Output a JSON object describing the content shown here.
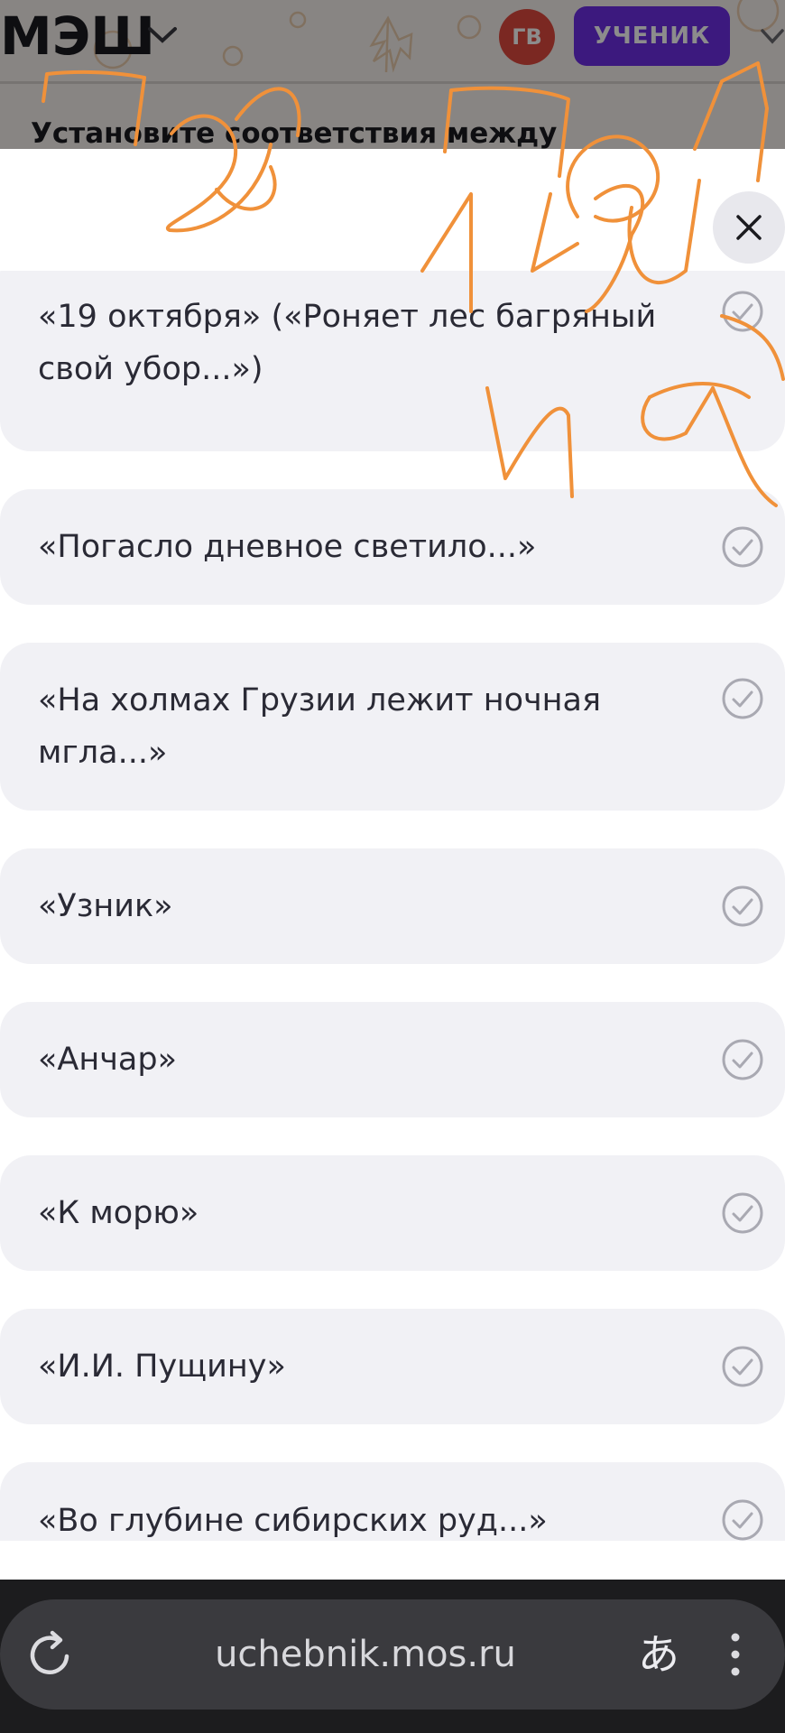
{
  "header": {
    "logo": "МЭШ",
    "avatar_initials": "ГВ",
    "role_label": "УЧЕНИК",
    "task_title": "Установите соответствия между"
  },
  "modal": {
    "options": [
      {
        "label": "«19 октября» («Роняет лес багряный свой убор...»)"
      },
      {
        "label": "«Погасло дневное светило...»"
      },
      {
        "label": "«На холмах Грузии лежит ночная мгла...»"
      },
      {
        "label": "«Узник»"
      },
      {
        "label": "«Анчар»"
      },
      {
        "label": "«К морю»"
      },
      {
        "label": "«И.И. Пущину»"
      },
      {
        "label": "«Во глубине сибирских руд...»"
      }
    ]
  },
  "browser": {
    "url": "uchebnik.mos.ru",
    "translate_glyph": "あ"
  },
  "colors": {
    "avatar": "#e04a3f",
    "role_button": "#6d2ee6",
    "option_bg": "#f1f1f5",
    "check": "#a9a9b2",
    "handwriting": "#f0913a"
  },
  "icons": [
    "chevron-down-icon",
    "close-icon",
    "check-circle-icon",
    "reload-icon",
    "translate-icon",
    "more-vert-icon"
  ]
}
